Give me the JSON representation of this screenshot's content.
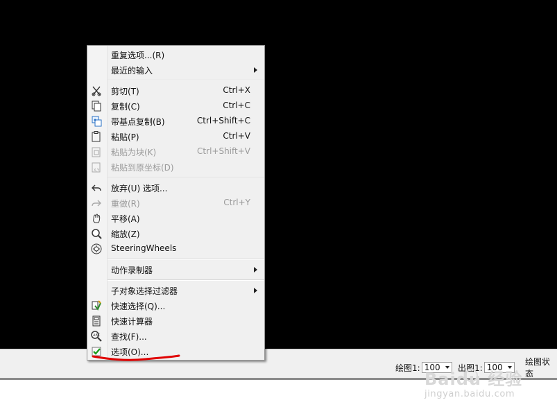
{
  "menu": {
    "items": [
      {
        "label": "重复选项...(R)",
        "shortcut": "",
        "submenu": false,
        "disabled": false,
        "icon": "none"
      },
      {
        "label": "最近的输入",
        "shortcut": "",
        "submenu": true,
        "disabled": false,
        "icon": "none"
      },
      {
        "label": "剪切(T)",
        "shortcut": "Ctrl+X",
        "submenu": false,
        "disabled": false,
        "icon": "scissors-icon"
      },
      {
        "label": "复制(C)",
        "shortcut": "Ctrl+C",
        "submenu": false,
        "disabled": false,
        "icon": "copy-icon"
      },
      {
        "label": "带基点复制(B)",
        "shortcut": "Ctrl+Shift+C",
        "submenu": false,
        "disabled": false,
        "icon": "copy-base-point-icon"
      },
      {
        "label": "粘贴(P)",
        "shortcut": "Ctrl+V",
        "submenu": false,
        "disabled": false,
        "icon": "paste-icon"
      },
      {
        "label": "粘贴为块(K)",
        "shortcut": "Ctrl+Shift+V",
        "submenu": false,
        "disabled": true,
        "icon": "paste-block-icon"
      },
      {
        "label": "粘贴到原坐标(D)",
        "shortcut": "",
        "submenu": false,
        "disabled": true,
        "icon": "paste-coordinates-icon"
      },
      {
        "label": "放弃(U) 选项...",
        "shortcut": "",
        "submenu": false,
        "disabled": false,
        "icon": "undo-icon"
      },
      {
        "label": "重做(R)",
        "shortcut": "Ctrl+Y",
        "submenu": false,
        "disabled": true,
        "icon": "redo-icon"
      },
      {
        "label": "平移(A)",
        "shortcut": "",
        "submenu": false,
        "disabled": false,
        "icon": "pan-hand-icon"
      },
      {
        "label": "缩放(Z)",
        "shortcut": "",
        "submenu": false,
        "disabled": false,
        "icon": "zoom-icon"
      },
      {
        "label": "SteeringWheels",
        "shortcut": "",
        "submenu": false,
        "disabled": false,
        "icon": "steering-wheel-icon"
      },
      {
        "label": "动作录制器",
        "shortcut": "",
        "submenu": true,
        "disabled": false,
        "icon": "none"
      },
      {
        "label": "子对象选择过滤器",
        "shortcut": "",
        "submenu": true,
        "disabled": false,
        "icon": "none"
      },
      {
        "label": "快速选择(Q)...",
        "shortcut": "",
        "submenu": false,
        "disabled": false,
        "icon": "quick-select-icon"
      },
      {
        "label": "快速计算器",
        "shortcut": "",
        "submenu": false,
        "disabled": false,
        "icon": "calculator-icon"
      },
      {
        "label": "查找(F)...",
        "shortcut": "",
        "submenu": false,
        "disabled": false,
        "icon": "find-icon"
      },
      {
        "label": "选项(O)...",
        "shortcut": "",
        "submenu": false,
        "disabled": false,
        "icon": "options-check-icon"
      }
    ]
  },
  "status_bar": {
    "drawing_scale_label": "绘图1:",
    "drawing_scale_value": "100",
    "plot_scale_label": "出图1:",
    "plot_scale_value": "100",
    "drawing_status_label": "绘图状态"
  },
  "watermark": {
    "brand_text": "Baidu 经验",
    "url_text": "jingyan.baidu.com"
  },
  "colors": {
    "canvas_background": "#000000",
    "menu_background": "#f0f0f0",
    "red_annotation": "#e00000",
    "disabled_text": "#9a9a9a"
  }
}
